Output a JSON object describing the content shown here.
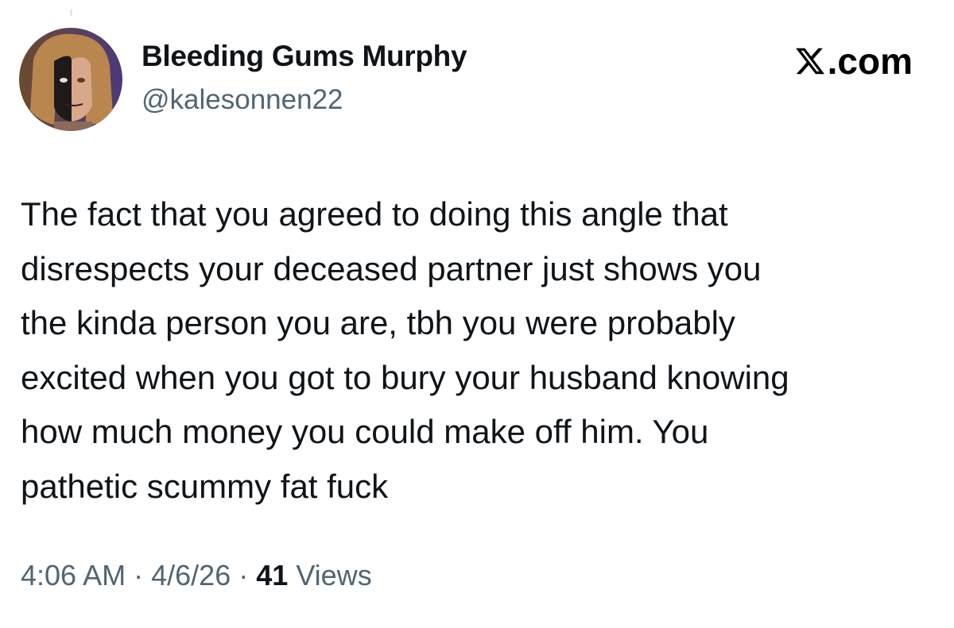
{
  "author": {
    "display_name": "Bleeding Gums Murphy",
    "handle": "@kalesonnen22"
  },
  "brand": {
    "logo_icon": "x-logo-icon",
    "suffix": ".com"
  },
  "tweet": {
    "lines": [
      "The fact that you agreed to doing this angle that",
      "disrespects your deceased partner just shows you",
      "the kinda person you are, tbh you were probably",
      "excited when you got to bury your husband knowing",
      "how much money you could make off him. You",
      "pathetic scummy fat fuck"
    ]
  },
  "meta": {
    "time": "4:06 AM",
    "separator": "·",
    "date": "4/6/26",
    "views_count": "41",
    "views_label": "Views"
  },
  "colors": {
    "text_primary": "#0f1419",
    "text_secondary": "#536471",
    "background": "#ffffff"
  }
}
